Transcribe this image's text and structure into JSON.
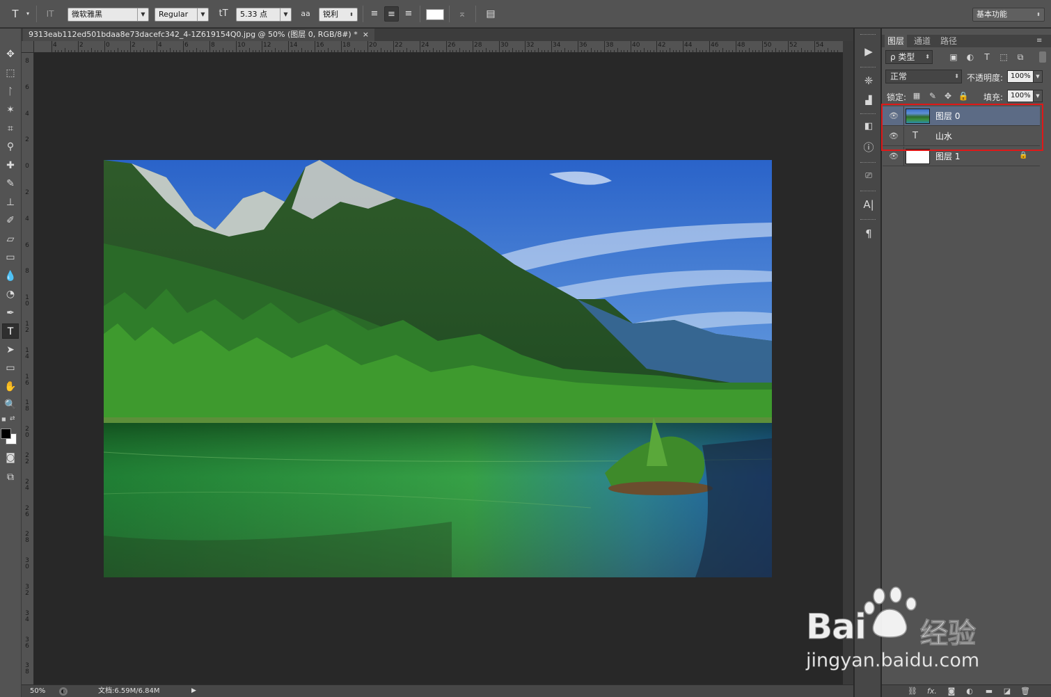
{
  "options_bar": {
    "type_tool_icon": "T",
    "type_orient_icon": "IT",
    "font_family": "微软雅黑",
    "font_style": "Regular",
    "font_size_icon": "tT",
    "font_size": "5.33 点",
    "aa_icon": "aa",
    "antialias": "锐利",
    "text_color": "#ffffff",
    "workspace": "基本功能"
  },
  "document": {
    "tab_title": "9313eab112ed501bdaa8e73dacefc342_4-1Z619154Q0.jpg @ 50% (图层 0, RGB/8#) *",
    "close_glyph": "×"
  },
  "rulers": {
    "horizontal": [
      "4",
      "2",
      "0",
      "2",
      "4",
      "6",
      "8",
      "10",
      "12",
      "14",
      "16",
      "18",
      "20",
      "22",
      "24",
      "26",
      "28",
      "30",
      "32",
      "34",
      "36",
      "38",
      "40",
      "42",
      "44",
      "46",
      "48",
      "50",
      "52",
      "54"
    ],
    "vertical": [
      "8",
      "6",
      "4",
      "2",
      "0",
      "2",
      "4",
      "6",
      "8",
      "10",
      "12",
      "14",
      "16",
      "18",
      "20",
      "22",
      "24",
      "26",
      "28",
      "30",
      "32",
      "34",
      "36",
      "38"
    ]
  },
  "status_bar": {
    "zoom": "50%",
    "doc_info": "文档:6.59M/6.84M",
    "arrow": "▶"
  },
  "layers_panel": {
    "tabs": [
      "图层",
      "通道",
      "路径"
    ],
    "filter_kind": "ρ 类型",
    "blend_mode": "正常",
    "opacity_label": "不透明度:",
    "opacity_value": "100%",
    "lock_label": "锁定:",
    "fill_label": "填充:",
    "fill_value": "100%",
    "layers": [
      {
        "name": "图层 0",
        "kind": "image",
        "selected": true,
        "visible": true
      },
      {
        "name": "山水",
        "kind": "text",
        "selected": false,
        "visible": true,
        "glyph": "T"
      },
      {
        "name": "图层 1",
        "kind": "fill",
        "selected": false,
        "visible": true,
        "locked": true
      }
    ],
    "bottom_icons": [
      "link-icon",
      "fx-icon",
      "mask-icon",
      "adjustment-icon",
      "folder-icon",
      "new-layer-icon",
      "trash-icon"
    ],
    "fx_label": "fx."
  },
  "colors": {
    "foreground": "#000000",
    "background": "#ffffff",
    "highlight_box": "#e01818",
    "selected_layer": "#5c6b85"
  },
  "watermark": {
    "brand": "Bai",
    "brand2": "经验",
    "url": "jingyan.baidu.com"
  }
}
